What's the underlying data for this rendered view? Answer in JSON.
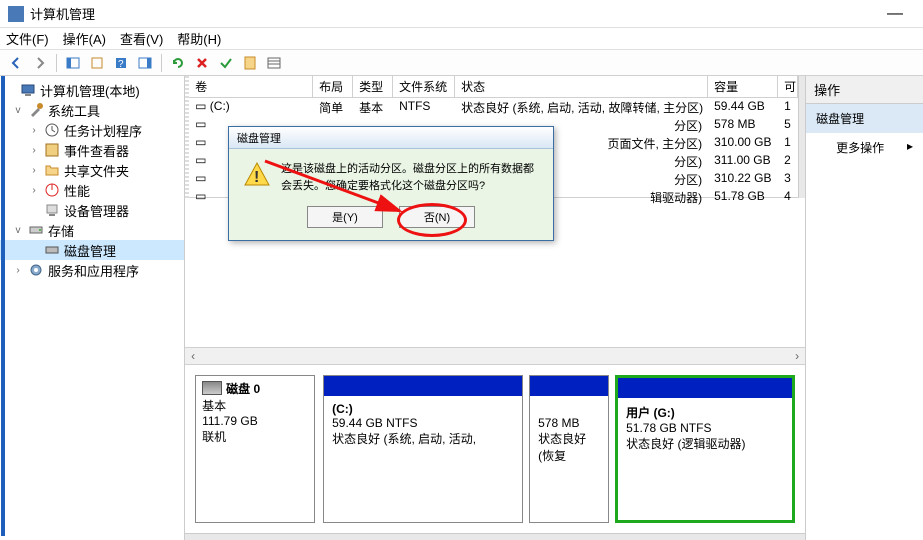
{
  "window": {
    "title": "计算机管理",
    "minimize": "—"
  },
  "menu": {
    "file": "文件(F)",
    "action": "操作(A)",
    "view": "查看(V)",
    "help": "帮助(H)"
  },
  "tree": {
    "root": "计算机管理(本地)",
    "system_tools": "系统工具",
    "task_scheduler": "任务计划程序",
    "event_viewer": "事件查看器",
    "shared_folders": "共享文件夹",
    "performance": "性能",
    "device_manager": "设备管理器",
    "storage": "存储",
    "disk_management": "磁盘管理",
    "services_apps": "服务和应用程序"
  },
  "vol_headers": {
    "volume": "卷",
    "layout": "布局",
    "type": "类型",
    "filesystem": "文件系统",
    "status": "状态",
    "capacity": "容量",
    "available": "可"
  },
  "volumes": [
    {
      "name": "(C:)",
      "layout": "简单",
      "type": "基本",
      "fs": "NTFS",
      "status": "状态良好 (系统, 启动, 活动, 故障转储, 主分区)",
      "cap": "59.44 GB",
      "avail": "1"
    },
    {
      "name": "",
      "layout": "",
      "type": "",
      "fs": "",
      "status": "分区)",
      "cap": "578 MB",
      "avail": "5"
    },
    {
      "name": "",
      "layout": "",
      "type": "",
      "fs": "",
      "status": "页面文件, 主分区)",
      "cap": "310.00 GB",
      "avail": "1"
    },
    {
      "name": "",
      "layout": "",
      "type": "",
      "fs": "",
      "status": "分区)",
      "cap": "311.00 GB",
      "avail": "2"
    },
    {
      "name": "",
      "layout": "",
      "type": "",
      "fs": "",
      "status": "分区)",
      "cap": "310.22 GB",
      "avail": "3"
    },
    {
      "name": "",
      "layout": "",
      "type": "",
      "fs": "",
      "status": "辑驱动器)",
      "cap": "51.78 GB",
      "avail": "4"
    }
  ],
  "disk": {
    "label": "磁盘 0",
    "type": "基本",
    "size": "111.79 GB",
    "state": "联机",
    "part_c_name": "(C:)",
    "part_c_size": "59.44 GB NTFS",
    "part_c_status": "状态良好 (系统, 启动, 活动,",
    "part_mid_size": "578 MB",
    "part_mid_status": "状态良好 (恢复",
    "part_g_name": "用户 (G:)",
    "part_g_size": "51.78 GB NTFS",
    "part_g_status": "状态良好 (逻辑驱动器)"
  },
  "actions": {
    "header": "操作",
    "disk_mgmt": "磁盘管理",
    "more": "更多操作"
  },
  "dialog": {
    "title": "磁盘管理",
    "message": "这是该磁盘上的活动分区。磁盘分区上的所有数据都会丢失。您确定要格式化这个磁盘分区吗?",
    "yes": "是(Y)",
    "no": "否(N)"
  }
}
